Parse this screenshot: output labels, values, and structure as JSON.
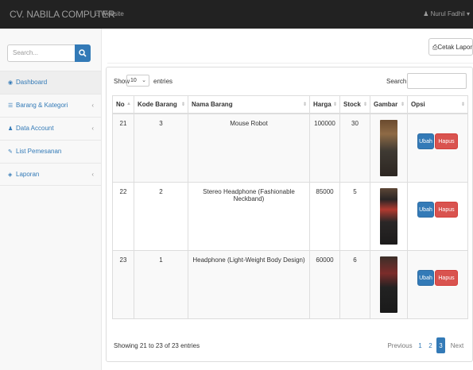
{
  "navbar": {
    "brand": "CV. NABILA COMPUTER",
    "website_label": "Website",
    "user_label": "Nurul Fadhil"
  },
  "sidebar": {
    "search_placeholder": "Search...",
    "items": [
      {
        "label": "Dashboard",
        "icon": "dashboard-icon",
        "active": true
      },
      {
        "label": "Barang & Kategori",
        "icon": "list-icon",
        "has_submenu": true
      },
      {
        "label": "Data Account",
        "icon": "users-icon",
        "has_submenu": true
      },
      {
        "label": "List Pemesanan",
        "icon": "edit-icon",
        "has_submenu": false
      },
      {
        "label": "Laporan",
        "icon": "report-icon",
        "has_submenu": true
      }
    ]
  },
  "toolbar": {
    "report_label": "Cetak Laporan"
  },
  "table_controls": {
    "show_label": "Show",
    "entries_value": "10",
    "entries_label": "entries",
    "search_label": "Search:"
  },
  "table": {
    "columns": [
      "No",
      "Kode Barang",
      "Nama Barang",
      "Harga",
      "Stock",
      "Gambar",
      "Opsi"
    ],
    "rows": [
      {
        "no": "21",
        "kode": "3",
        "nama": "Mouse Robot",
        "harga": "100000",
        "stock": "30"
      },
      {
        "no": "22",
        "kode": "2",
        "nama": "Stereo Headphone (Fashionable Neckband)",
        "harga": "85000",
        "stock": "5"
      },
      {
        "no": "23",
        "kode": "1",
        "nama": "Headphone (Light-Weight Body Design)",
        "harga": "60000",
        "stock": "6"
      }
    ],
    "edit_label": "Ubah",
    "delete_label": "Hapus"
  },
  "footer": {
    "info": "Showing 21 to 23 of 23 entries",
    "pagination": {
      "previous": "Previous",
      "pages": [
        "1",
        "2",
        "3"
      ],
      "current": "3",
      "next": "Next"
    }
  },
  "colors": {
    "primary": "#337ab7",
    "danger": "#d9534f",
    "navbar": "#222222"
  }
}
